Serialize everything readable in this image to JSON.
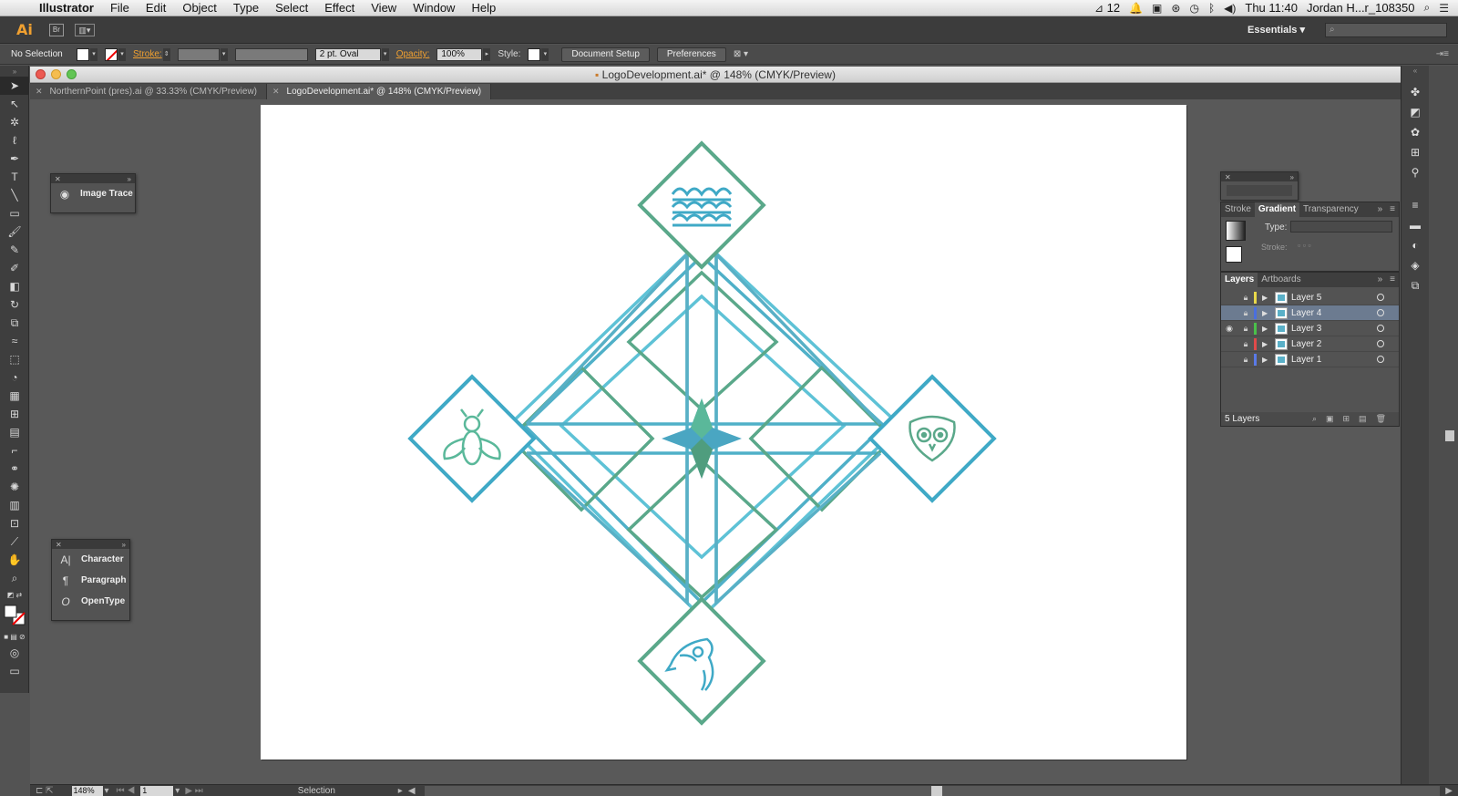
{
  "menubar": {
    "app": "Illustrator",
    "items": [
      "File",
      "Edit",
      "Object",
      "Type",
      "Select",
      "Effect",
      "View",
      "Window",
      "Help"
    ],
    "adobe_count": "12",
    "clock": "Thu 11:40",
    "user": "Jordan H...r_108350"
  },
  "appbar": {
    "logo": "Ai",
    "bridge": "Br",
    "workspace": "Essentials"
  },
  "control": {
    "selection": "No Selection",
    "stroke_label": "Stroke:",
    "brush": "2 pt. Oval",
    "opacity_label": "Opacity:",
    "opacity_value": "100%",
    "style_label": "Style:",
    "doc_setup": "Document Setup",
    "preferences": "Preferences"
  },
  "document": {
    "window_title": "LogoDevelopment.ai* @ 148% (CMYK/Preview)",
    "tabs": [
      {
        "label": "NorthernPoint (pres).ai @ 33.33% (CMYK/Preview)"
      },
      {
        "label": "LogoDevelopment.ai* @ 148% (CMYK/Preview)"
      }
    ]
  },
  "panels": {
    "image_trace": "Image Trace",
    "type_panels": [
      {
        "icon": "A|",
        "label": "Character"
      },
      {
        "icon": "¶",
        "label": "Paragraph"
      },
      {
        "icon": "O",
        "label": "OpenType"
      }
    ],
    "gradient": {
      "tabs": [
        "Stroke",
        "Gradient",
        "Transparency"
      ],
      "type_label": "Type:",
      "stroke_label": "Stroke:"
    },
    "layers": {
      "tabs": [
        "Layers",
        "Artboards"
      ],
      "rows": [
        {
          "name": "Layer 5",
          "color": "#e8d84a",
          "visible": false,
          "selected": false
        },
        {
          "name": "Layer 4",
          "color": "#4a6fe0",
          "visible": false,
          "selected": true
        },
        {
          "name": "Layer 3",
          "color": "#4ac04a",
          "visible": true,
          "selected": false
        },
        {
          "name": "Layer 2",
          "color": "#e04a4a",
          "visible": false,
          "selected": false
        },
        {
          "name": "Layer 1",
          "color": "#5a7ae8",
          "visible": false,
          "selected": false
        }
      ],
      "count": "5 Layers"
    }
  },
  "status": {
    "zoom": "148%",
    "page": "1",
    "tool": "Selection"
  },
  "colors": {
    "blue": "#3fa9c6",
    "green": "#5aa88a",
    "teal": "#58b8b0"
  }
}
